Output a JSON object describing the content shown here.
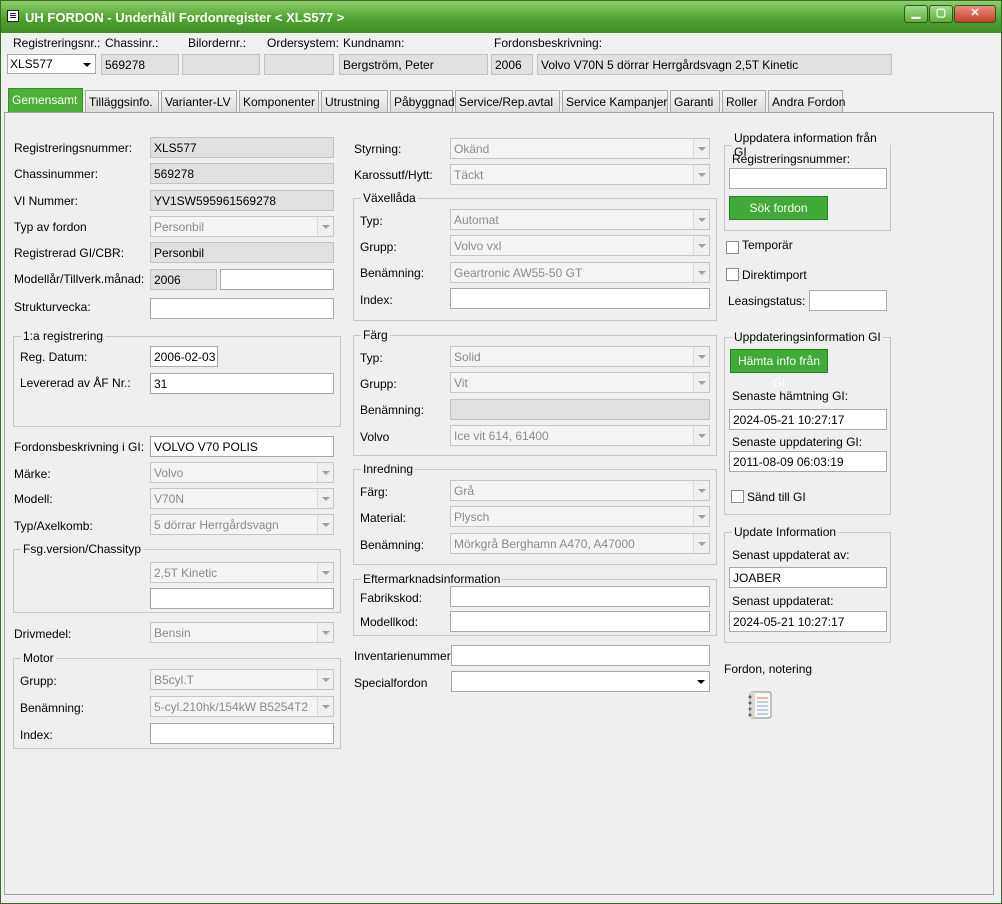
{
  "window": {
    "title": "UH FORDON - Underhåll Fordonregister  < XLS577 >",
    "min": "▁",
    "max": "▢",
    "close": "✕"
  },
  "header": {
    "reg_label": "Registreringsnr.:",
    "reg_value": "XLS577",
    "chassis_label": "Chassinr.:",
    "chassis_value": "569278",
    "bilorder_label": "Bilordernr.:",
    "bilorder_value": "",
    "ordersystem_label": "Ordersystem:",
    "ordersystem_value": "",
    "kundnamn_label": "Kundnamn:",
    "kundnamn_value": "Bergström, Peter",
    "desc_label": "Fordonsbeskrivning:",
    "desc_year": "2006",
    "desc_value": "Volvo V70N 5 dörrar Herrgårdsvagn 2,5T Kinetic"
  },
  "tabs": [
    "Gemensamt",
    "Tilläggsinfo.",
    "Varianter-LV",
    "Komponenter",
    "Utrustning",
    "Påbyggnad",
    "Service/Rep.avtal",
    "Service Kampanjer",
    "Garanti",
    "Roller",
    "Andra Fordon"
  ],
  "left": {
    "reg_label": "Registreringsnummer:",
    "reg_value": "XLS577",
    "chassis_label": "Chassinummer:",
    "chassis_value": "569278",
    "vin_label": "VI Nummer:",
    "vin_value": "YV1SW595961569278",
    "type_label": "Typ av fordon",
    "type_value": "Personbil",
    "regtype_label": "Registrerad GI/CBR:",
    "regtype_value": "Personbil",
    "model_year_label": "Modellår/Tillverk.månad:",
    "model_year_value": "2006",
    "manuf_month_value": "",
    "struct_label": "Strukturvecka:",
    "struct_value": "",
    "first_reg": {
      "legend": "1:a registrering",
      "date_label": "Reg. Datum:",
      "date_value": "2006-02-03",
      "delivered_label": "Levererad av ÅF Nr.:",
      "delivered_value": "31"
    },
    "gi_desc_label": "Fordonsbeskrivning i GI:",
    "gi_desc_value": "VOLVO V70 POLIS",
    "brand_label": "Märke:",
    "brand_value": "Volvo",
    "modell_label": "Modell:",
    "modell_value": "V70N",
    "axle_label": "Typ/Axelkomb:",
    "axle_value": "5 dörrar Herrgårdsvagn",
    "fsg": {
      "legend": "Fsg.version/Chassityp",
      "value": "2,5T Kinetic",
      "value2": ""
    },
    "fuel_label": "Drivmedel:",
    "fuel_value": "Bensin",
    "motor": {
      "legend": "Motor",
      "group_label": "Grupp:",
      "group_value": "B5cyl.T",
      "name_label": "Benämning:",
      "name_value": "5-cyl.210hk/154kW B5254T2",
      "index_label": "Index:",
      "index_value": ""
    }
  },
  "middle": {
    "steering_label": "Styrning:",
    "steering_value": "Okänd",
    "body_label": "Karossutf/Hytt:",
    "body_value": "Täckt",
    "gearbox": {
      "legend": "Växellåda",
      "type_label": "Typ:",
      "type_value": "Automat",
      "group_label": "Grupp:",
      "group_value": "Volvo vxl",
      "name_label": "Benämning:",
      "name_value": "Geartronic AW55-50 GT",
      "index_label": "Index:",
      "index_value": ""
    },
    "color": {
      "legend": "Färg",
      "type_label": "Typ:",
      "type_value": "Solid",
      "group_label": "Grupp:",
      "group_value": "Vit",
      "name_label": "Benämning:",
      "name_value": "",
      "volvo_label": "Volvo",
      "volvo_value": "Ice vit 614, 61400"
    },
    "interior": {
      "legend": "Inredning",
      "color_label": "Färg:",
      "color_value": "Grå",
      "material_label": "Material:",
      "material_value": "Plysch",
      "name_label": "Benämning:",
      "name_value": "Mörkgrå Berghamn A470, A47000"
    },
    "aftermarket": {
      "legend": "Eftermarknadsinformation",
      "factory_label": "Fabrikskod:",
      "factory_value": "",
      "model_label": "Modellkod:",
      "model_value": ""
    },
    "inventory_label": "Inventarienummer",
    "inventory_value": "",
    "special_label": "Specialfordon",
    "special_value": ""
  },
  "right": {
    "update_gi": {
      "legend": "Uppdatera information från GI",
      "reg_label": "Registreringsnummer:",
      "reg_value": "",
      "search_button": "Sök fordon"
    },
    "temporary_label": "Temporär",
    "direct_import_label": "Direktimport",
    "leasing_label": "Leasingstatus:",
    "leasing_value": "",
    "update_info_gi": {
      "legend": "Uppdateringsinformation GI",
      "fetch_button": "Hämta info från GI",
      "last_fetch_label": "Senaste hämtning GI:",
      "last_fetch_value": "2024-05-21 10:27:17",
      "last_update_label": "Senaste uppdatering GI:",
      "last_update_value": "2011-08-09 06:03:19",
      "sent_label": "Sänd till GI"
    },
    "update_info": {
      "legend": "Update Information",
      "updated_by_label": "Senast uppdaterat av:",
      "updated_by_value": "JOABER",
      "updated_label": "Senast uppdaterat:",
      "updated_value": "2024-05-21 10:27:17"
    },
    "note_label": "Fordon, notering"
  }
}
